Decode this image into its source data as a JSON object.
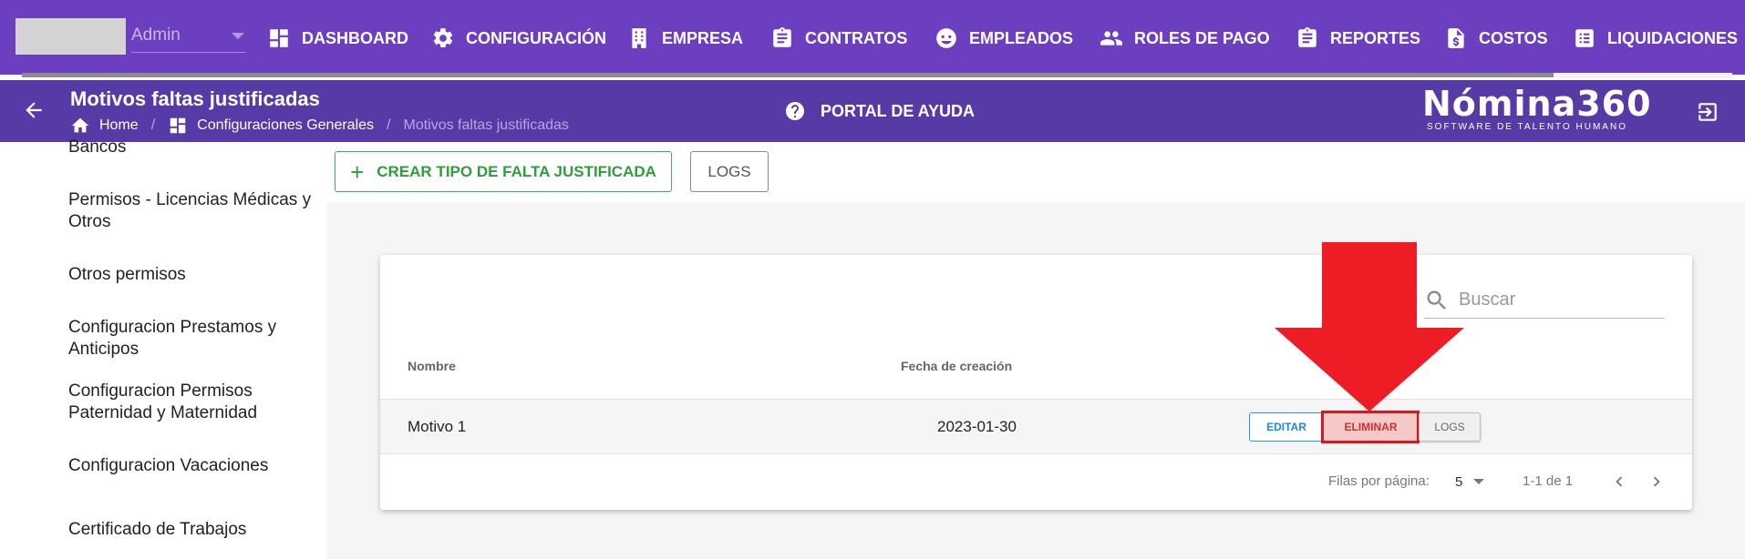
{
  "nav": {
    "user": "Admin",
    "items": [
      {
        "label": "DASHBOARD",
        "icon": "dashboard-icon"
      },
      {
        "label": "CONFIGURACIÓN",
        "icon": "gear-icon"
      },
      {
        "label": "EMPRESA",
        "icon": "building-icon"
      },
      {
        "label": "CONTRATOS",
        "icon": "clipboard-icon"
      },
      {
        "label": "EMPLEADOS",
        "icon": "face-icon"
      },
      {
        "label": "ROLES DE PAGO",
        "icon": "people-icon"
      },
      {
        "label": "REPORTES",
        "icon": "clipboard-icon"
      },
      {
        "label": "COSTOS",
        "icon": "dollar-file-icon"
      },
      {
        "label": "LIQUIDACIONES",
        "icon": "list-icon"
      }
    ]
  },
  "header": {
    "title": "Motivos faltas justificadas",
    "breadcrumb": {
      "home": "Home",
      "sep": "/",
      "config": "Configuraciones Generales",
      "current": "Motivos faltas justificadas"
    },
    "help": "PORTAL DE AYUDA",
    "brand": "Nómina360",
    "brand_tagline": "SOFTWARE DE TALENTO HUMANO"
  },
  "sidebar": {
    "items": [
      {
        "label": "Bancos"
      },
      {
        "label": "Permisos - Licencias Médicas y Otros"
      },
      {
        "label": "Otros permisos"
      },
      {
        "label": "Configuracion Prestamos y Anticipos"
      },
      {
        "label": "Configuracion Permisos Paternidad y Maternidad"
      },
      {
        "label": "Configuracion Vacaciones"
      },
      {
        "label": "Certificado de Trabajos"
      }
    ]
  },
  "actions": {
    "create": "CREAR TIPO DE FALTA JUSTIFICADA",
    "logs": "LOGS"
  },
  "table": {
    "search_placeholder": "Buscar",
    "headers": {
      "name": "Nombre",
      "date": "Fecha de creación"
    },
    "rows": [
      {
        "name": "Motivo 1",
        "date": "2023-01-30",
        "edit": "EDITAR",
        "delete": "ELIMINAR",
        "logs": "LOGS"
      }
    ],
    "pagination": {
      "rows_label": "Filas por página:",
      "rows_value": "5",
      "range": "1-1 de 1"
    }
  },
  "colors": {
    "nav_bg": "#6b3fbf",
    "header_bg": "#583aa6",
    "create_green": "#3cb34a",
    "edit_blue": "#2196f3",
    "delete_red": "#d32f2f",
    "annotation_red": "#e0141b"
  }
}
